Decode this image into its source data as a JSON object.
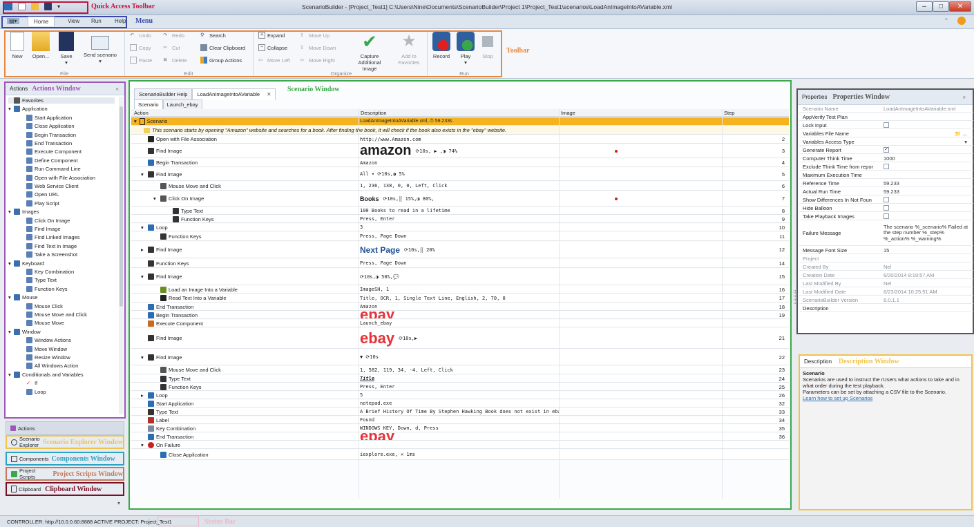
{
  "window": {
    "title": "ScenarioBuilder - [Project_Test1] C:\\Users\\Nine\\Documents\\ScenarioBuilder\\Project 1\\Project_Test1\\scenarios\\LoadAnImageIntoAVariable.xml",
    "minimize": "–",
    "maximize": "□",
    "close": "✕"
  },
  "annotations": {
    "quick_access": "Quick Access Toolbar",
    "menu": "Menu",
    "toolbar": "Toolbar",
    "actions_window": "Actions Window",
    "scenario_window": "Scenario Window",
    "properties_window": "Properties Window",
    "description_window": "Description Window",
    "scenario_explorer": "Scenario Explorer Window",
    "components_window": "Components Window",
    "project_scripts": "Project Scripts Window",
    "clipboard_window": "Clipboard Window",
    "status_bar": "Status Bar"
  },
  "menu": {
    "file": "▤▾",
    "home": "Home",
    "view": "View",
    "run": "Run",
    "help": "Help"
  },
  "ribbon": {
    "new": "New",
    "open": "Open...",
    "save": "Save",
    "send": "Send scenario",
    "undo": "Undo",
    "redo": "Redo",
    "search": "Search",
    "copy": "Copy",
    "cut": "Cut",
    "clear_clipboard": "Clear Clipboard",
    "paste": "Paste",
    "delete": "Delete",
    "group_actions": "Group Actions",
    "expand": "Expand",
    "move_up": "Move Up",
    "collapse": "Collapse",
    "move_down": "Move Down",
    "move_left": "Move Left",
    "move_right": "Move Right",
    "capture": "Capture Additional Image",
    "add_fav": "Add to Favorites",
    "record": "Record",
    "play": "Play",
    "stop": "Stop",
    "groups": {
      "file": "File",
      "edit": "Edit",
      "organize": "Organize",
      "run": "Run"
    }
  },
  "actions_panel": {
    "title": "Actions",
    "collapse": "«",
    "items": [
      {
        "label": "Favorites",
        "icon": "star-icon",
        "level": 0,
        "expander": ""
      },
      {
        "label": "Application",
        "icon": "application-icon",
        "level": 0,
        "expander": "▾"
      },
      {
        "label": "Start Application",
        "icon": "start-application-icon",
        "level": 1,
        "expander": ""
      },
      {
        "label": "Close Application",
        "icon": "close-application-icon",
        "level": 1,
        "expander": ""
      },
      {
        "label": "Begin Transaction",
        "icon": "begin-transaction-icon",
        "level": 1,
        "expander": ""
      },
      {
        "label": "End Transaction",
        "icon": "end-transaction-icon",
        "level": 1,
        "expander": ""
      },
      {
        "label": "Execute Component",
        "icon": "execute-component-icon",
        "level": 1,
        "expander": ""
      },
      {
        "label": "Define Component",
        "icon": "define-component-icon",
        "level": 1,
        "expander": ""
      },
      {
        "label": "Run Command Line",
        "icon": "command-line-icon",
        "level": 1,
        "expander": ""
      },
      {
        "label": "Open with File Association",
        "icon": "file-association-icon",
        "level": 1,
        "expander": ""
      },
      {
        "label": "Web Service Client",
        "icon": "web-service-icon",
        "level": 1,
        "expander": ""
      },
      {
        "label": "Open URL",
        "icon": "open-url-icon",
        "level": 1,
        "expander": ""
      },
      {
        "label": "Play Script",
        "icon": "play-script-icon",
        "level": 1,
        "expander": ""
      },
      {
        "label": "Images",
        "icon": "images-icon",
        "level": 0,
        "expander": "▾"
      },
      {
        "label": "Click On Image",
        "icon": "click-image-icon",
        "level": 1,
        "expander": ""
      },
      {
        "label": "Find Image",
        "icon": "find-image-icon",
        "level": 1,
        "expander": ""
      },
      {
        "label": "Find Linked Images",
        "icon": "find-linked-images-icon",
        "level": 1,
        "expander": ""
      },
      {
        "label": "Find Text in Image",
        "icon": "find-text-image-icon",
        "level": 1,
        "expander": ""
      },
      {
        "label": "Take a Screenshot",
        "icon": "screenshot-icon",
        "level": 1,
        "expander": ""
      },
      {
        "label": "Keyboard",
        "icon": "keyboard-icon",
        "level": 0,
        "expander": "▾"
      },
      {
        "label": "Key Combination",
        "icon": "key-combination-icon",
        "level": 1,
        "expander": ""
      },
      {
        "label": "Type Text",
        "icon": "type-text-icon",
        "level": 1,
        "expander": ""
      },
      {
        "label": "Function Keys",
        "icon": "function-keys-icon",
        "level": 1,
        "expander": ""
      },
      {
        "label": "Mouse",
        "icon": "mouse-icon",
        "level": 0,
        "expander": "▾"
      },
      {
        "label": "Mouse Click",
        "icon": "mouse-click-icon",
        "level": 1,
        "expander": ""
      },
      {
        "label": "Mouse Move and Click",
        "icon": "mouse-move-click-icon",
        "level": 1,
        "expander": ""
      },
      {
        "label": "Mouse Move",
        "icon": "mouse-move-icon",
        "level": 1,
        "expander": ""
      },
      {
        "label": "Window",
        "icon": "window-icon",
        "level": 0,
        "expander": "▾"
      },
      {
        "label": "Window Actions",
        "icon": "window-actions-icon",
        "level": 1,
        "expander": ""
      },
      {
        "label": "Move Window",
        "icon": "move-window-icon",
        "level": 1,
        "expander": ""
      },
      {
        "label": "Resize Window",
        "icon": "resize-window-icon",
        "level": 1,
        "expander": ""
      },
      {
        "label": "All Windows Action",
        "icon": "all-windows-icon",
        "level": 1,
        "expander": ""
      },
      {
        "label": "Conditionals and Variables",
        "icon": "conditionals-icon",
        "level": 0,
        "expander": "▾"
      },
      {
        "label": "If",
        "icon": "if-icon",
        "level": 1,
        "expander": ""
      },
      {
        "label": "Loop",
        "icon": "loop-icon",
        "level": 1,
        "expander": ""
      }
    ]
  },
  "side_tabs": {
    "actions": "Actions",
    "explorer": "Scenario Explorer",
    "components": "Components",
    "scripts": "Project Scripts",
    "clipboard": "Clipboard"
  },
  "scenario": {
    "doc_tabs": [
      "ScenarioBuilder Help",
      "LoadAnImageIntoAVariable"
    ],
    "doc_tab_close": "✕",
    "sub_tabs": [
      "Scenario",
      "Launch_ebay"
    ],
    "columns": {
      "action": "Action",
      "description": "Description",
      "image": "Image",
      "step": "Step"
    },
    "header_row": {
      "action": "Scenario",
      "description": "LoadAnImageIntoAVariable.xml, ⏱ 59.233s"
    },
    "comment": "This scenario starts by opening \"Amazon\" website and searches for a book. After finding the book, it will check if the book also exists in the \"ebay\" website.",
    "rows": [
      {
        "action": "Open with File Association",
        "description": "http://www.Amazon.com",
        "step": "2",
        "icon": "file-association-icon",
        "indent": 0,
        "expander": ""
      },
      {
        "action": "Find Image",
        "description": "amazon",
        "extra": "⟳10s, ▶ ,◑ 74%",
        "step": "3",
        "icon": "find-image-icon",
        "indent": 0,
        "expander": ""
      },
      {
        "action": "Begin Transaction",
        "description": "Amazon",
        "step": "4",
        "icon": "begin-transaction-icon",
        "indent": 0,
        "expander": ""
      },
      {
        "action": "Find Image",
        "description": "All ▾ ⟳10s,◑ 5%",
        "step": "5",
        "icon": "find-image-icon",
        "indent": 0,
        "expander": "▾"
      },
      {
        "action": "Mouse Move and Click",
        "description": "1, 236, 138, 0, 0, Left, Click",
        "step": "6",
        "icon": "mouse-move-click-icon",
        "indent": 1,
        "expander": ""
      },
      {
        "action": "Click On Image",
        "description": "Books",
        "extra": "⟳10s,⣿ 15%,◑ 80%,",
        "step": "7",
        "icon": "click-image-icon",
        "indent": 1,
        "expander": "▾"
      },
      {
        "action": "Type Text",
        "description": "100 Books to read in a lifetime",
        "step": "8",
        "icon": "type-text-icon",
        "indent": 2,
        "expander": ""
      },
      {
        "action": "Function Keys",
        "description": "Press, Enter",
        "step": "9",
        "icon": "function-keys-icon",
        "indent": 2,
        "expander": ""
      },
      {
        "action": "Loop",
        "description": "3",
        "step": "10",
        "icon": "loop-icon",
        "indent": 0,
        "expander": "▾"
      },
      {
        "action": "Function Keys",
        "description": "Press, Page Down",
        "step": "11",
        "icon": "function-keys-icon",
        "indent": 1,
        "expander": ""
      },
      {
        "action": "Find Image",
        "description": "Next Page",
        "extra": "⟳10s,⣿ 20%",
        "step": "12",
        "icon": "find-image-icon",
        "indent": 0,
        "expander": "▸"
      },
      {
        "action": "Function Keys",
        "description": "Press, Page Down",
        "step": "14",
        "icon": "function-keys-icon",
        "indent": 0,
        "expander": ""
      },
      {
        "action": "Find Image",
        "description": "⟳10s,◑ 50%,💬",
        "step": "15",
        "icon": "find-image-icon",
        "indent": 0,
        "expander": "▾"
      },
      {
        "action": "Load an Image Into a Variable",
        "description": "ImageSH, 1",
        "step": "16",
        "icon": "load-image-variable-icon",
        "indent": 1,
        "expander": ""
      },
      {
        "action": "Read Text Into a Variable",
        "description": "Title, OCR, 1, Single Text Line, English, 2, 70, 0",
        "step": "17",
        "icon": "read-text-icon",
        "indent": 1,
        "expander": ""
      },
      {
        "action": "End Transaction",
        "description": "Amazon",
        "step": "18",
        "icon": "end-transaction-icon",
        "indent": 0,
        "expander": ""
      },
      {
        "action": "Begin Transaction",
        "description": "ebay",
        "step": "19",
        "icon": "begin-transaction-icon",
        "indent": 0,
        "expander": ""
      },
      {
        "action": "Execute Component",
        "description": "Launch_ebay",
        "step": "",
        "icon": "execute-component-icon",
        "indent": 0,
        "expander": ""
      },
      {
        "action": "Find Image",
        "description": "ebay",
        "extra": "⟳10s,▶",
        "step": "21",
        "icon": "find-image-icon",
        "indent": 0,
        "expander": ""
      },
      {
        "action": "Find Image",
        "description": "▼ ⟳10s",
        "step": "22",
        "icon": "find-image-icon",
        "indent": 0,
        "expander": "▾"
      },
      {
        "action": "Mouse Move and Click",
        "description": "1, 582, 119, 34, -4, Left, Click",
        "step": "23",
        "icon": "mouse-move-click-icon",
        "indent": 1,
        "expander": ""
      },
      {
        "action": "Type Text",
        "description": "Title",
        "step": "24",
        "icon": "type-text-icon",
        "indent": 1,
        "expander": ""
      },
      {
        "action": "Function Keys",
        "description": "Press, Enter",
        "step": "25",
        "icon": "function-keys-icon",
        "indent": 1,
        "expander": ""
      },
      {
        "action": "Loop",
        "description": "5",
        "step": "26",
        "icon": "loop-icon",
        "indent": 0,
        "expander": "▸"
      },
      {
        "action": "Start Application",
        "description": "notepad.exe",
        "step": "32",
        "icon": "start-application-icon",
        "indent": 0,
        "expander": ""
      },
      {
        "action": "Type Text",
        "description": "A Brief History Of Time By Stephen Hawking Book does not exist in ebay webiste!",
        "step": "33",
        "icon": "type-text-icon",
        "indent": 0,
        "expander": ""
      },
      {
        "action": "Label",
        "description": "Found",
        "step": "34",
        "icon": "label-icon",
        "indent": 0,
        "expander": ""
      },
      {
        "action": "Key Combination",
        "description": "WINDOWS KEY, Down, d, Press",
        "step": "35",
        "icon": "key-combination-icon",
        "indent": 0,
        "expander": ""
      },
      {
        "action": "End Transaction",
        "description": "ebay",
        "step": "36",
        "icon": "end-transaction-icon",
        "indent": 0,
        "expander": ""
      },
      {
        "action": "On Failure",
        "description": "",
        "step": "",
        "icon": "on-failure-icon",
        "indent": 0,
        "expander": "▾"
      },
      {
        "action": "Close Application",
        "description": "iexplore.exe, ✕ 1ms",
        "step": "",
        "icon": "close-application-icon",
        "indent": 1,
        "expander": ""
      }
    ]
  },
  "properties": {
    "title": "Properties",
    "expand": "»",
    "rows": [
      {
        "key": "Scenario Name",
        "value": "LoadAnImageIntoAVariable.xml",
        "dim": true
      },
      {
        "key": "AppVerify Test Plan",
        "value": "",
        "dim": false
      },
      {
        "key": "Lock Input",
        "value": "☐",
        "dim": false
      },
      {
        "key": "Variables File Name",
        "value": "📁 ...",
        "dim": false
      },
      {
        "key": "Variables Access Type",
        "value": "▾",
        "dim": false
      },
      {
        "key": "Generate Report",
        "value": "✓",
        "dim": false
      },
      {
        "key": "Computer Think Time",
        "value": "1000",
        "dim": false
      },
      {
        "key": "Exclude Think Time from repor",
        "value": "☐",
        "dim": false
      },
      {
        "key": "Maximum Execution Time",
        "value": "",
        "dim": false
      },
      {
        "key": "Reference Time",
        "value": "59.233",
        "dim": false
      },
      {
        "key": "Actual Run Time",
        "value": "59.233",
        "dim": false
      },
      {
        "key": "Show Differences In Not Foun",
        "value": "☐",
        "dim": false
      },
      {
        "key": "Hide Balloon",
        "value": "☐",
        "dim": false
      },
      {
        "key": "Take Playback Images",
        "value": "☐",
        "dim": false
      },
      {
        "key": "Failure Message",
        "value": "The scenario %_scenario% Failed at the step number %_step% %_action% %_warning%",
        "dim": false,
        "tall": true
      },
      {
        "key": "Message Font Size",
        "value": "15",
        "dim": false
      },
      {
        "key": "Project",
        "value": "",
        "dim": true
      },
      {
        "key": "Created By",
        "value": "Nel",
        "dim": true
      },
      {
        "key": "Creation Date",
        "value": "6/20/2014 8:19:57 AM",
        "dim": true
      },
      {
        "key": "Last Modified By",
        "value": "Nel",
        "dim": true
      },
      {
        "key": "Last Modified Date",
        "value": "6/23/2014 10:25:51 AM",
        "dim": true
      },
      {
        "key": "ScenarioBuilder Version",
        "value": "8.0.1.1",
        "dim": true
      },
      {
        "key": "Description",
        "value": "",
        "dim": false
      }
    ]
  },
  "description": {
    "title": "Description",
    "heading": "Scenario",
    "body": "Scenarios are used to instruct the rUsers what actions to take and in what order during the test playback.\nParameters can be set by attaching a CSV file to the Scenario.",
    "link": "Learn how to set up Scenarios"
  },
  "status": {
    "text": "CONTROLLER:  http://10.0.0.60:8888   ACTIVE PROJECT:  Project_Test1"
  },
  "colors": {
    "selection": "#f5b321",
    "accent": "#2a6db5"
  }
}
